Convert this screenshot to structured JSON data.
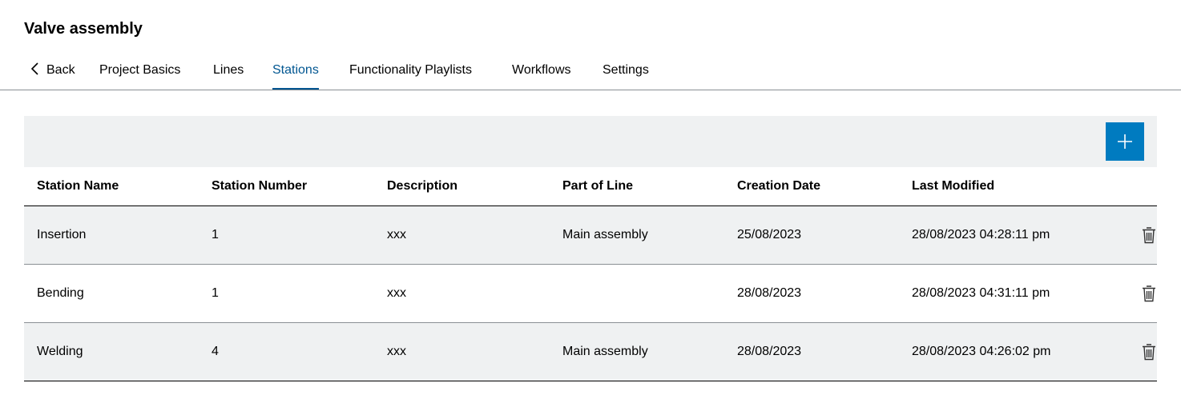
{
  "page": {
    "title": "Valve assembly"
  },
  "tabs": {
    "back": "Back",
    "items": [
      {
        "label": "Project Basics"
      },
      {
        "label": "Lines"
      },
      {
        "label": "Stations"
      },
      {
        "label": "Functionality Playlists"
      },
      {
        "label": "Workflows"
      },
      {
        "label": "Settings"
      }
    ],
    "active": "Stations"
  },
  "toolbar": {
    "add_icon": "plus-icon"
  },
  "table": {
    "columns": [
      "Station Name",
      "Station Number",
      "Description",
      "Part of Line",
      "Creation Date",
      "Last Modified"
    ],
    "rows": [
      {
        "name": "Insertion",
        "number": "1",
        "description": "xxx",
        "line": "Main assembly",
        "created": "25/08/2023",
        "modified": "28/08/2023 04:28:11 pm"
      },
      {
        "name": "Bending",
        "number": "1",
        "description": "xxx",
        "line": "",
        "created": "28/08/2023",
        "modified": "28/08/2023 04:31:11 pm"
      },
      {
        "name": "Welding",
        "number": "4",
        "description": "xxx",
        "line": "Main assembly",
        "created": "28/08/2023",
        "modified": "28/08/2023 04:26:02 pm"
      }
    ]
  },
  "colors": {
    "accent": "#005691",
    "button": "#007bc0",
    "row_shade": "#eff1f2"
  }
}
